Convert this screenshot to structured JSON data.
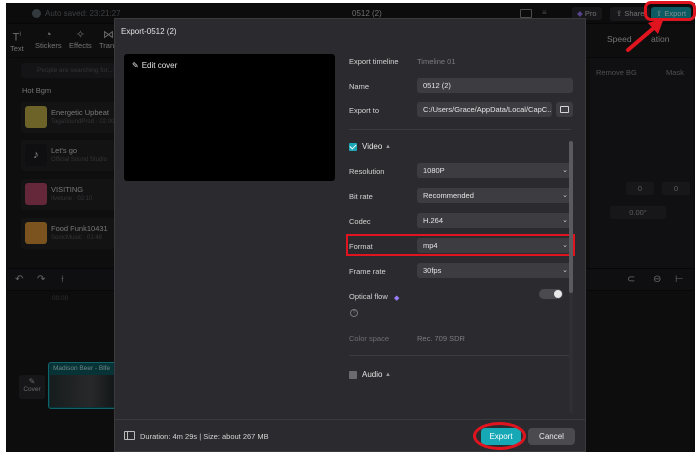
{
  "titlebar": {
    "autosave": "Auto saved: 23:21:27",
    "project_title": "0512 (2)",
    "pro_label": "Pro",
    "share_label": "Share",
    "export_label": "Export"
  },
  "toolbar": {
    "tools": [
      "Text",
      "Stickers",
      "Effects",
      "Trans"
    ],
    "right_tabs": [
      "Speed",
      "ation"
    ]
  },
  "library": {
    "search_placeholder": "People are searching for...",
    "section_title": "Hot Bgm",
    "songs": [
      {
        "title": "Energetic Upbeat",
        "artist": "TagaSoundProd · 02:00",
        "color": "#c6b24a"
      },
      {
        "title": "Let's go",
        "artist": "Official Sound Studio",
        "color": "#1d1d1f"
      },
      {
        "title": "VISITING",
        "artist": "Ilvetune · 02:10",
        "color": "#b84a6c"
      },
      {
        "title": "Food Funk10431",
        "artist": "SonicMusic · 01:48",
        "color": "#e0983a"
      }
    ]
  },
  "properties": {
    "tabs": [
      "Remove BG",
      "Mask"
    ],
    "x_value": "0",
    "y_value": "0",
    "rotation": "0.00°"
  },
  "timeline": {
    "time": "00:00",
    "cover_label": "Cover",
    "clip_title": "Madison Beer - Blfe"
  },
  "dialog": {
    "title": "Export-0512 (2)",
    "edit_cover": "Edit cover",
    "fields": {
      "export_timeline_label": "Export timeline",
      "export_timeline_value": "Timeline 01",
      "name_label": "Name",
      "name_value": "0512 (2)",
      "export_to_label": "Export to",
      "export_to_value": "C:/Users/Grace/AppData/Local/CapC..."
    },
    "video": {
      "label": "Video",
      "resolution_label": "Resolution",
      "resolution_value": "1080P",
      "bitrate_label": "Bit rate",
      "bitrate_value": "Recommended",
      "codec_label": "Codec",
      "codec_value": "H.264",
      "format_label": "Format",
      "format_value": "mp4",
      "framerate_label": "Frame rate",
      "framerate_value": "30fps",
      "optical_flow_label": "Optical flow",
      "colorspace_label": "Color space",
      "colorspace_value": "Rec. 709 SDR"
    },
    "audio": {
      "label": "Audio"
    },
    "footer": {
      "duration": "Duration: 4m 29s | Size: about 267 MB",
      "export_label": "Export",
      "cancel_label": "Cancel"
    }
  },
  "colors": {
    "accent": "#17a8b6",
    "annotation": "#e0141f",
    "dialog_bg": "#2b2b2f"
  }
}
